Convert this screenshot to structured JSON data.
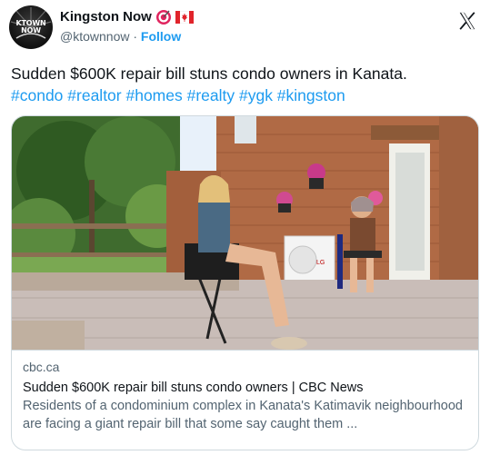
{
  "account": {
    "name": "Kingston Now",
    "handle": "@ktownnow",
    "separator": "·",
    "follow_label": "Follow",
    "avatar_text": "KTOWN NOW",
    "badges": [
      "target-badge-icon",
      "canada-flag-icon"
    ]
  },
  "tweet": {
    "text": "Sudden $600K repair bill stuns condo owners in Kanata.",
    "hashtags": "#condo #realtor #homes #realty #ygk #kingston"
  },
  "card": {
    "domain": "cbc.ca",
    "title": "Sudden $600K repair bill stuns condo owners | CBC News",
    "description": "Residents of a condominium complex in Kanata's Katimavik neighbourhood are facing a giant repair bill that some say caught them ...",
    "ac_unit_label": "LG"
  },
  "colors": {
    "link": "#1d9bf0",
    "secondary_text": "#536471",
    "border": "#cfd9de"
  }
}
